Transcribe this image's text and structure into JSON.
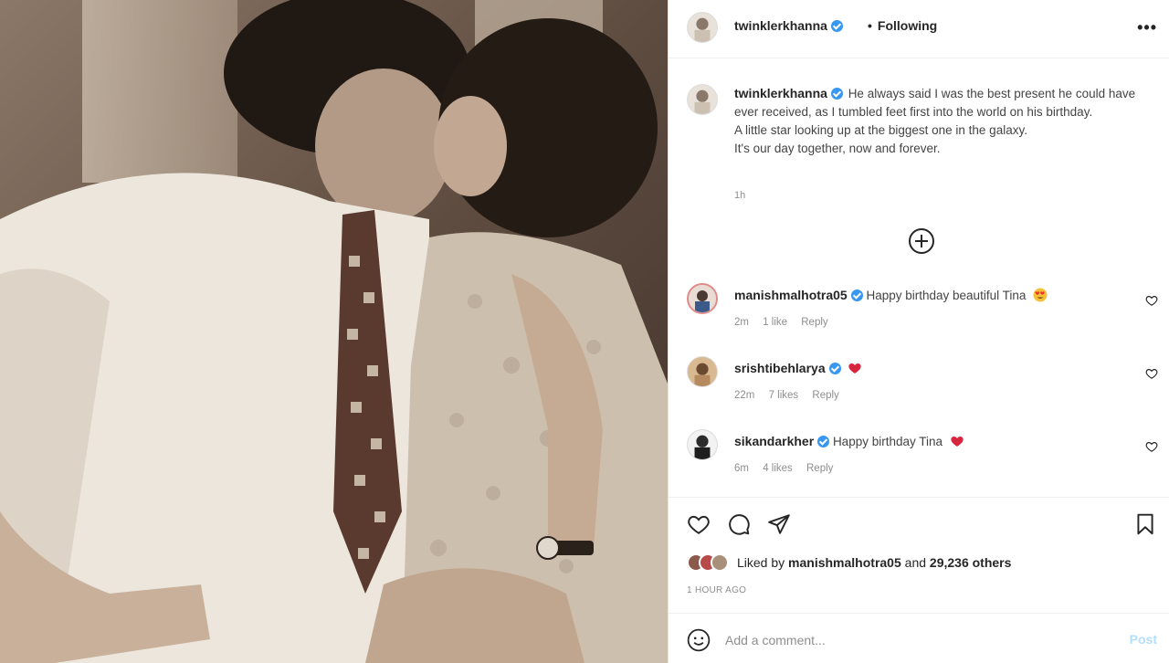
{
  "header": {
    "username": "twinklerkhanna",
    "separator": "•",
    "follow_status": "Following",
    "more_label": "•••"
  },
  "caption": {
    "username": "twinklerkhanna",
    "text": "He always said I was the best present he could have ever received, as I tumbled feet first into the world on his birthday.",
    "line2": "A little star looking up at the biggest one in the galaxy.",
    "line3": "It's our day together, now and forever.",
    "time": "1h"
  },
  "comments": [
    {
      "username": "manishmalhotra05",
      "text": "Happy birthday beautiful Tina",
      "emoji": "heart-eyes-emoji",
      "time": "2m",
      "likes": "1 like",
      "reply": "Reply"
    },
    {
      "username": "srishtibehlarya",
      "text": "",
      "emoji": "red-heart-emoji",
      "time": "22m",
      "likes": "7 likes",
      "reply": "Reply"
    },
    {
      "username": "sikandarkher",
      "text": "Happy birthday Tina",
      "emoji": "red-heart-emoji",
      "time": "6m",
      "likes": "4 likes",
      "reply": "Reply"
    }
  ],
  "actions": {
    "like_icon": "heart-outline-icon",
    "comment_icon": "comment-bubble-icon",
    "share_icon": "paper-plane-icon",
    "save_icon": "bookmark-icon"
  },
  "likes": {
    "prefix": "Liked by",
    "user": "manishmalhotra05",
    "joiner": "and",
    "others": "29,236 others"
  },
  "post_time": "1 HOUR AGO",
  "add_comment": {
    "placeholder": "Add a comment...",
    "post_label": "Post"
  },
  "colors": {
    "verified": "#3897f0",
    "post_disabled": "#b2dffc",
    "heart": "#ed2848"
  }
}
